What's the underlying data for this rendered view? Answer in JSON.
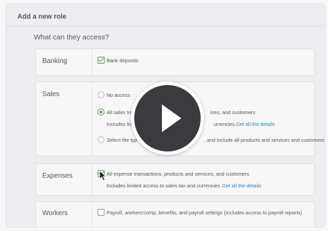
{
  "dialog": {
    "title": "Add a new role",
    "question": "What can they access?"
  },
  "banking": {
    "label": "Banking",
    "bank_deposits": "Bank deposits"
  },
  "sales": {
    "label": "Sales",
    "no_access": "No access",
    "all_sales_prefix": "All sales tra",
    "all_sales_suffix": "ices, and customers",
    "includes_prefix": "Includes limit",
    "includes_suffix": "urrencies.",
    "get_details": "Get all the details",
    "select_prefix": "Select the typ",
    "select_suffix": ", and include all products and services and customers"
  },
  "expenses": {
    "label": "Expenses",
    "all_expense": "All expense transactions, products and services, and customers",
    "includes": "Includes limited access to sales tax and currencies.",
    "get_details": "Get all the details"
  },
  "workers": {
    "label": "Workers",
    "payroll": "Payroll, workers'comp, benefits, and payroll settings (includes access to payroll reports)"
  },
  "video": {
    "icon": "play-icon"
  },
  "colors": {
    "accent_green": "#2ca01c",
    "link_blue": "#0077c5",
    "play_button": "#3a3b3e"
  }
}
